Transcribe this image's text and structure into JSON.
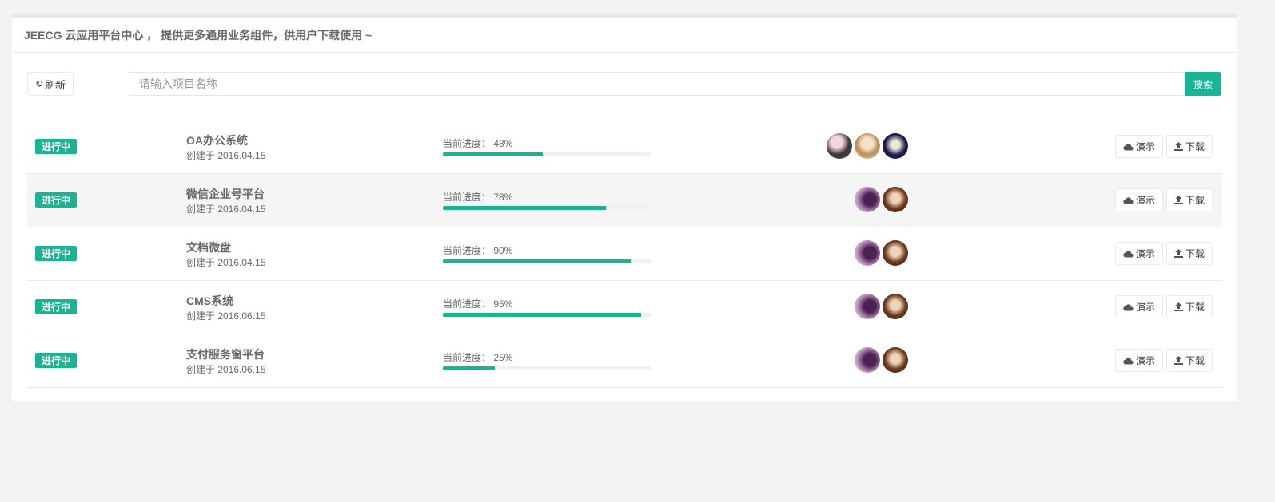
{
  "header": {
    "title": "JEECG 云应用平台中心 ， 提供更多通用业务组件，供用户下载使用 ~"
  },
  "toolbar": {
    "refresh_label": "刷新",
    "search_placeholder": "请输入项目名称",
    "search_button": "搜索"
  },
  "projects": [
    {
      "status": "进行中",
      "name": "OA办公系统",
      "created": "创建于 2016.04.15",
      "progress_label": "当前进度： 48%",
      "progress": 48,
      "avatars": [
        "avatar-1",
        "avatar-2",
        "avatar-3"
      ],
      "demo_label": "演示",
      "download_label": "下载"
    },
    {
      "status": "进行中",
      "name": "微信企业号平台",
      "created": "创建于 2016.04.15",
      "progress_label": "当前进度： 78%",
      "progress": 78,
      "avatars": [
        "avatar-4",
        "avatar-5"
      ],
      "demo_label": "演示",
      "download_label": "下载"
    },
    {
      "status": "进行中",
      "name": "文档微盘",
      "created": "创建于 2016.04.15",
      "progress_label": "当前进度： 90%",
      "progress": 90,
      "avatars": [
        "avatar-4",
        "avatar-5"
      ],
      "demo_label": "演示",
      "download_label": "下载"
    },
    {
      "status": "进行中",
      "name": "CMS系统",
      "created": "创建于 2016.06.15",
      "progress_label": "当前进度： 95%",
      "progress": 95,
      "avatars": [
        "avatar-4",
        "avatar-5"
      ],
      "demo_label": "演示",
      "download_label": "下载"
    },
    {
      "status": "进行中",
      "name": "支付服务窗平台",
      "created": "创建于 2016.06.15",
      "progress_label": "当前进度： 25%",
      "progress": 25,
      "avatars": [
        "avatar-4",
        "avatar-5"
      ],
      "demo_label": "演示",
      "download_label": "下载"
    }
  ],
  "colors": {
    "accent": "#1ab394",
    "text": "#676a6c",
    "background": "#f3f3f4"
  }
}
